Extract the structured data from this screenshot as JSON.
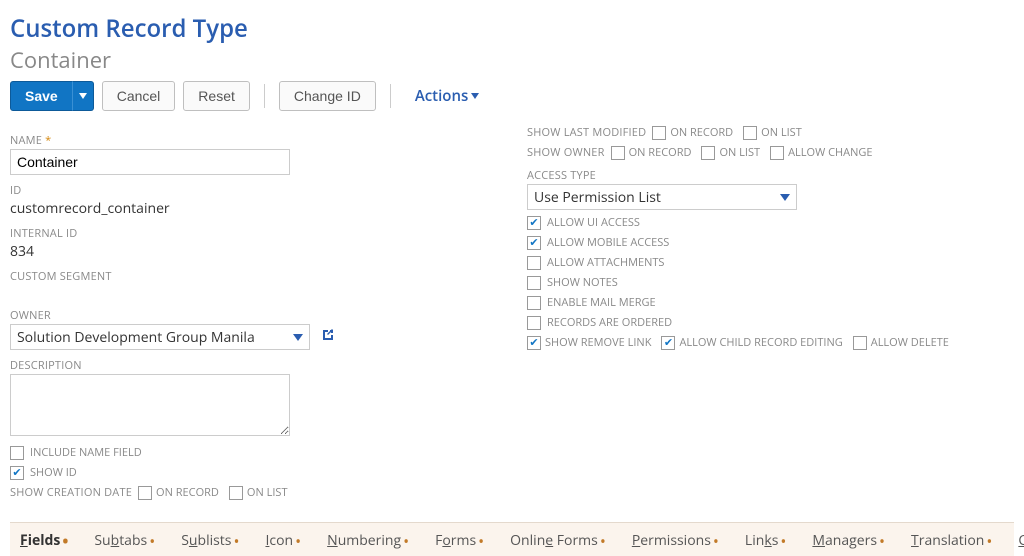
{
  "header": {
    "title": "Custom Record Type",
    "subtitle": "Container"
  },
  "toolbar": {
    "save": "Save",
    "cancel": "Cancel",
    "reset": "Reset",
    "change_id": "Change ID",
    "actions": "Actions"
  },
  "left": {
    "name_label": "NAME",
    "name_value": "Container",
    "id_label": "ID",
    "id_value": "customrecord_container",
    "internal_id_label": "INTERNAL ID",
    "internal_id_value": "834",
    "custom_segment_label": "CUSTOM SEGMENT",
    "owner_label": "OWNER",
    "owner_value": "Solution Development Group Manila",
    "description_label": "DESCRIPTION",
    "include_name_field": "INCLUDE NAME FIELD",
    "show_id": "SHOW ID",
    "show_creation_date": "SHOW CREATION DATE",
    "on_record": "ON RECORD",
    "on_list": "ON LIST"
  },
  "right": {
    "show_last_modified": "SHOW LAST MODIFIED",
    "show_owner": "SHOW OWNER",
    "on_record": "ON RECORD",
    "on_list": "ON LIST",
    "allow_change": "ALLOW CHANGE",
    "access_type_label": "ACCESS TYPE",
    "access_type_value": "Use Permission List",
    "allow_ui_access": "ALLOW UI ACCESS",
    "allow_mobile_access": "ALLOW MOBILE ACCESS",
    "allow_attachments": "ALLOW ATTACHMENTS",
    "show_notes": "SHOW NOTES",
    "enable_mail_merge": "ENABLE MAIL MERGE",
    "records_are_ordered": "RECORDS ARE ORDERED",
    "show_remove_link": "SHOW REMOVE LINK",
    "allow_child_record_editing": "ALLOW CHILD RECORD EDITING",
    "allow_delete": "ALLOW DELETE"
  },
  "tabs": {
    "fields": "Fields",
    "subtabs": "Subtabs",
    "sublists": "Sublists",
    "icon": "Icon",
    "numbering": "Numbering",
    "forms": "Forms",
    "online_forms": "Online Forms",
    "permissions": "Permissions",
    "links": "Links",
    "managers": "Managers",
    "translation": "Translation",
    "child_records": "Child Records"
  }
}
